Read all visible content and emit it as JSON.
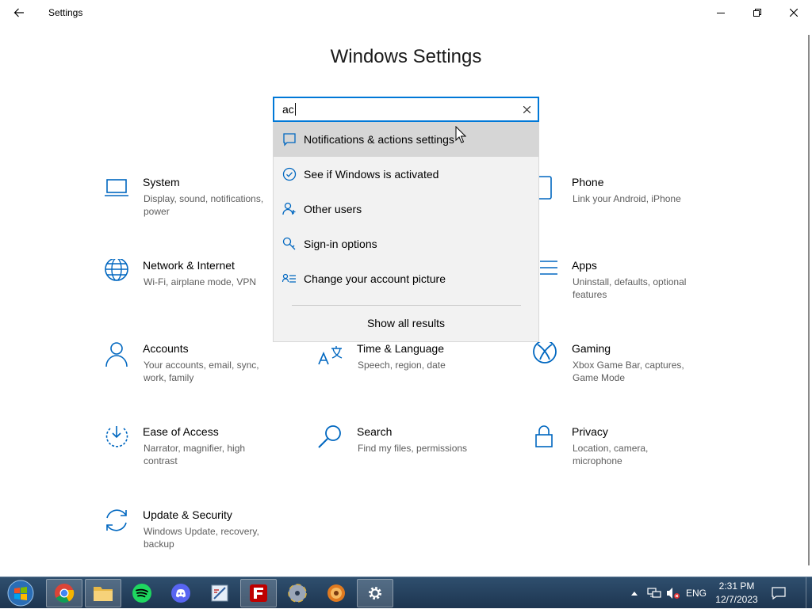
{
  "window": {
    "title": "Settings",
    "back_icon": "back-arrow-icon",
    "controls": [
      "minimize-icon",
      "maximize-icon",
      "close-icon"
    ]
  },
  "page": {
    "title": "Windows Settings"
  },
  "search": {
    "value": "ac",
    "clear_icon": "clear-x-icon"
  },
  "suggestions": [
    {
      "label": "Notifications & actions settings",
      "icon": "notification-icon"
    },
    {
      "label": "See if Windows is activated",
      "icon": "check-circle-icon"
    },
    {
      "label": "Other users",
      "icon": "user-plus-icon"
    },
    {
      "label": "Sign-in options",
      "icon": "key-icon"
    },
    {
      "label": "Change your account picture",
      "icon": "account-list-icon"
    }
  ],
  "show_all": "Show all results",
  "tiles": [
    {
      "name": "System",
      "desc": "Display, sound, notifications, power",
      "icon": "laptop-icon"
    },
    {
      "name": "Phone",
      "desc": "Link your Android, iPhone",
      "icon": "phone-icon"
    },
    {
      "name": "Network & Internet",
      "desc": "Wi-Fi, airplane mode, VPN",
      "icon": "globe-icon"
    },
    {
      "name": "Apps",
      "desc": "Uninstall, defaults, optional features",
      "icon": "apps-list-icon"
    },
    {
      "name": "Accounts",
      "desc": "Your accounts, email, sync, work, family",
      "icon": "person-icon"
    },
    {
      "name": "Time & Language",
      "desc": "Speech, region, date",
      "icon": "language-icon"
    },
    {
      "name": "Gaming",
      "desc": "Xbox Game Bar, captures, Game Mode",
      "icon": "xbox-icon"
    },
    {
      "name": "Ease of Access",
      "desc": "Narrator, magnifier, high contrast",
      "icon": "ease-of-access-icon"
    },
    {
      "name": "Search",
      "desc": "Find my files, permissions",
      "icon": "magnifier-icon"
    },
    {
      "name": "Privacy",
      "desc": "Location, camera, microphone",
      "icon": "lock-icon"
    },
    {
      "name": "Update & Security",
      "desc": "Windows Update, recovery, backup",
      "icon": "sync-icon"
    }
  ],
  "taskbar": {
    "apps": [
      "chrome-icon",
      "file-explorer-icon",
      "spotify-icon",
      "discord-icon",
      "paint-icon",
      "filezilla-icon",
      "disc-burner-icon",
      "media-player-icon",
      "settings-gear-icon"
    ],
    "language": "ENG",
    "time": "2:31 PM",
    "date": "12/7/2023"
  },
  "colors": {
    "accent": "#0078d7",
    "icon_blue": "#0067c0",
    "dropdown_bg": "#f2f2f2",
    "hover_bg": "#d6d6d6",
    "taskbar": "#24405e"
  }
}
